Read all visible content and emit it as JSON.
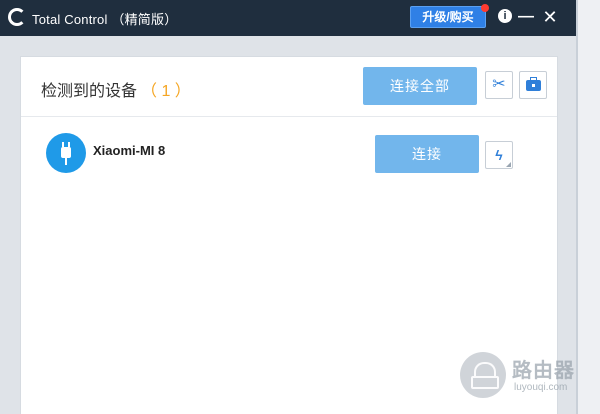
{
  "window": {
    "title": "Total Control （精简版）",
    "upgrade_label": "升级/购买",
    "controls": {
      "info": "i",
      "minimize": "—",
      "close": "✕"
    }
  },
  "devices_section": {
    "title": "检测到的设备",
    "count": "（ 1 ）",
    "connect_all_label": "连接全部",
    "tools_icon": "✂"
  },
  "devices": [
    {
      "name": "Xiaomi-MI 8",
      "connect_label": "连接",
      "flash_icon": "ϟ"
    }
  ],
  "watermark": {
    "name": "路由器",
    "url": "luyouqi.com"
  },
  "colors": {
    "titlebar": "#1f2e3e",
    "accent_button": "#72b6ec",
    "upgrade_button": "#2f80e6",
    "count_color": "#f5a623",
    "avatar": "#1f9ae8"
  }
}
